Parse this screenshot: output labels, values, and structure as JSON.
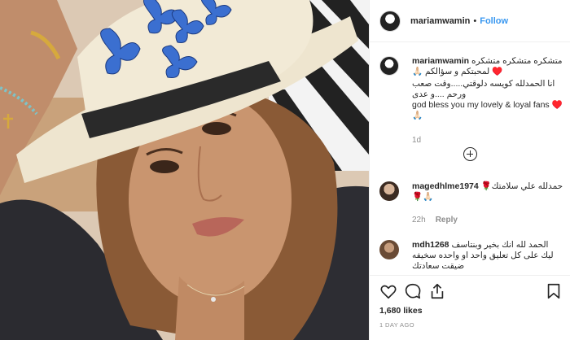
{
  "post": {
    "username": "mariamwamin",
    "separator": "•",
    "follow_label": "Follow"
  },
  "caption": {
    "username": "mariamwamin",
    "line1": "متشكره متشكره متشكره",
    "line2": "♥️ لمحبتكم و سؤالكم 🙏🏻",
    "line3": "انا الحمدلله كويسه دلوقتي.....وقت صعب ورحم ....و عدى",
    "line4": "god bless you my lovely & loyal fans ♥️",
    "line5": "🙏🏻",
    "time": "1d"
  },
  "comments": [
    {
      "username": "magedhlme1974",
      "text": "حمدلله علي سلامتك🌹",
      "text2": "🌹🙏🏻",
      "time": "22h",
      "reply_label": "Reply"
    },
    {
      "username": "mdh1268",
      "text": "الحمد لله انك بخير وبنتاسف",
      "text2": "ليك على كل تعليق واحد او واحده سخيفه",
      "text3": "ضيقت سعادتك"
    }
  ],
  "actions": {
    "likes": "1,680 likes",
    "date": "1 DAY AGO"
  },
  "icons": {
    "like": "heart-icon",
    "comment": "comment-bubble-icon",
    "share": "share-arrow-icon",
    "save": "bookmark-icon",
    "load_more": "plus-circle-icon"
  },
  "colors": {
    "link_blue": "#3897f0",
    "muted_gray": "#8e8e8e",
    "text": "#262626",
    "divider": "#efefef"
  }
}
